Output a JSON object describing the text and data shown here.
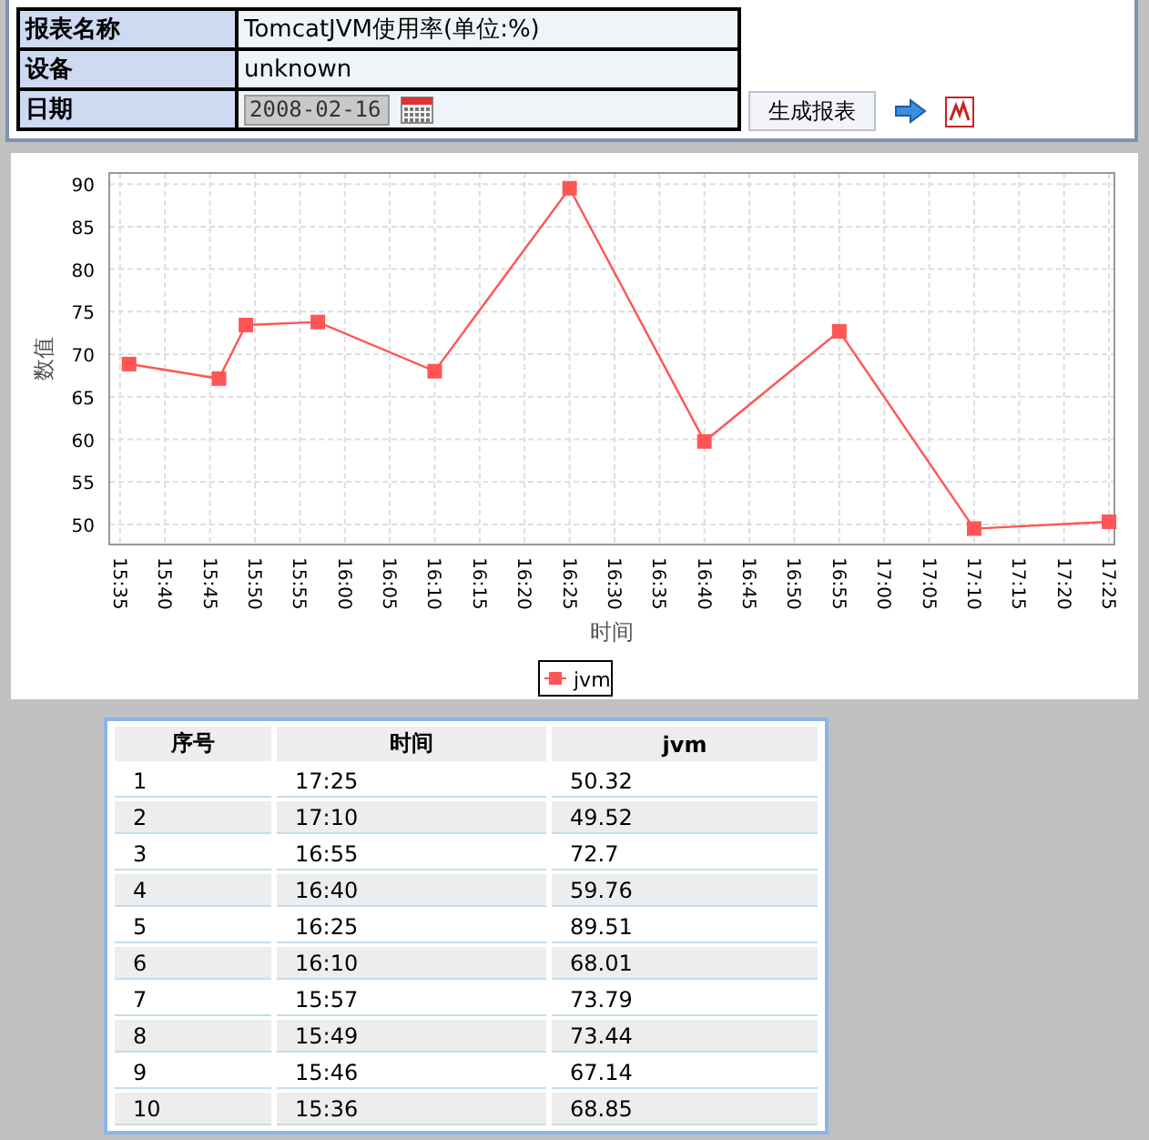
{
  "report_form": {
    "rows": [
      {
        "label": "报表名称",
        "value": "TomcatJVM使用率(单位:%)",
        "kind": "text"
      },
      {
        "label": "设备",
        "value": "unknown",
        "kind": "text"
      },
      {
        "label": "日期",
        "value": "2008-02-16",
        "kind": "date"
      }
    ],
    "generate_button": "生成报表"
  },
  "chart": {
    "chart_data": {
      "type": "line",
      "xlabel": "时间",
      "ylabel": "数值",
      "x": [
        936,
        946,
        949,
        957,
        970,
        985,
        1000,
        1015,
        1030,
        1045
      ],
      "series": [
        {
          "name": "jvm",
          "color": "#ff5555",
          "marker": "square",
          "values": [
            68.85,
            67.14,
            73.44,
            73.79,
            68.01,
            89.51,
            59.76,
            72.7,
            49.52,
            50.32
          ]
        }
      ],
      "grid": true,
      "xlim": [
        933.8,
        1045.6
      ],
      "ylim": [
        47.65,
        91.3
      ],
      "xticks": [
        {
          "value": 935,
          "label": "15:35"
        },
        {
          "value": 940,
          "label": "15:40"
        },
        {
          "value": 945,
          "label": "15:45"
        },
        {
          "value": 950,
          "label": "15:50"
        },
        {
          "value": 955,
          "label": "15:55"
        },
        {
          "value": 960,
          "label": "16:00"
        },
        {
          "value": 965,
          "label": "16:05"
        },
        {
          "value": 970,
          "label": "16:10"
        },
        {
          "value": 975,
          "label": "16:15"
        },
        {
          "value": 980,
          "label": "16:20"
        },
        {
          "value": 985,
          "label": "16:25"
        },
        {
          "value": 990,
          "label": "16:30"
        },
        {
          "value": 995,
          "label": "16:35"
        },
        {
          "value": 1000,
          "label": "16:40"
        },
        {
          "value": 1005,
          "label": "16:45"
        },
        {
          "value": 1010,
          "label": "16:50"
        },
        {
          "value": 1015,
          "label": "16:55"
        },
        {
          "value": 1020,
          "label": "17:00"
        },
        {
          "value": 1025,
          "label": "17:05"
        },
        {
          "value": 1030,
          "label": "17:10"
        },
        {
          "value": 1035,
          "label": "17:15"
        },
        {
          "value": 1040,
          "label": "17:20"
        },
        {
          "value": 1045,
          "label": "17:25"
        }
      ],
      "yticks": [
        50,
        55,
        60,
        65,
        70,
        75,
        80,
        85,
        90
      ]
    }
  },
  "table": {
    "columns": [
      "序号",
      "时间",
      "jvm"
    ],
    "rows": [
      [
        "1",
        "17:25",
        "50.32"
      ],
      [
        "2",
        "17:10",
        "49.52"
      ],
      [
        "3",
        "16:55",
        "72.7"
      ],
      [
        "4",
        "16:40",
        "59.76"
      ],
      [
        "5",
        "16:25",
        "89.51"
      ],
      [
        "6",
        "16:10",
        "68.01"
      ],
      [
        "7",
        "15:57",
        "73.79"
      ],
      [
        "8",
        "15:49",
        "73.44"
      ],
      [
        "9",
        "15:46",
        "67.14"
      ],
      [
        "10",
        "15:36",
        "68.85"
      ]
    ]
  }
}
